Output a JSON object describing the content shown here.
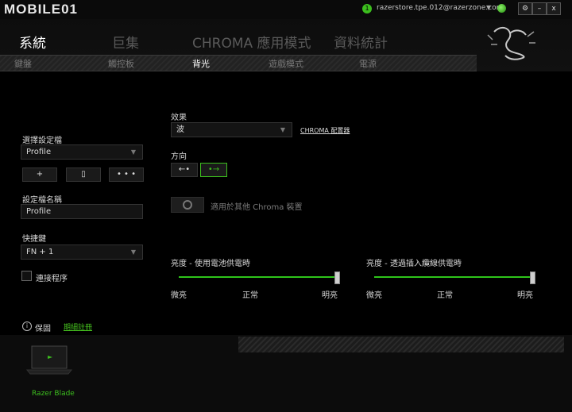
{
  "app": {
    "logo_text": "MOBILE01",
    "account": "razerstore.tpe.012@razerzone.com",
    "notifications": "1"
  },
  "window": {
    "settings": "⚙",
    "minimize": "–",
    "close": "x"
  },
  "tabs": [
    {
      "label": "系統",
      "active": true
    },
    {
      "label": "巨集",
      "active": false
    },
    {
      "label": "CHROMA 應用模式",
      "active": false
    },
    {
      "label": "資料統計",
      "active": false
    }
  ],
  "subtabs": [
    {
      "label": "鍵盤",
      "active": false
    },
    {
      "label": "觸控板",
      "active": false
    },
    {
      "label": "背光",
      "active": true
    },
    {
      "label": "遊戲模式",
      "active": false
    },
    {
      "label": "電源",
      "active": false
    }
  ],
  "profile": {
    "select_label": "選擇設定檔",
    "selected": "Profile",
    "add": "+",
    "remove": "▯",
    "more": "• • •",
    "name_label": "設定檔名稱",
    "name_value": "Profile",
    "hotkey_label": "快捷鍵",
    "hotkey_value": "FN + 1",
    "link_program_label": "連接程序"
  },
  "effect": {
    "label": "效果",
    "selected": "波",
    "chroma_config_link": "CHROMA 配置器",
    "direction_label": "方向",
    "dir_left": "←•",
    "dir_right": "•→",
    "apply_other_label": "適用於其他 Chroma 裝置"
  },
  "brightness": {
    "battery_label": "亮度 - 使用電池供電時",
    "plugged_label": "亮度 - 透過插入纜線供電時",
    "min": "微亮",
    "mid": "正常",
    "max": "明亮",
    "battery_value": 1.0,
    "plugged_value": 1.0
  },
  "footer": {
    "info_icon": "info-icon",
    "save_label": "保固",
    "register_link": "期細註冊"
  },
  "device": {
    "name": "Razer Blade"
  },
  "colors": {
    "accent": "#3cbe1e"
  }
}
